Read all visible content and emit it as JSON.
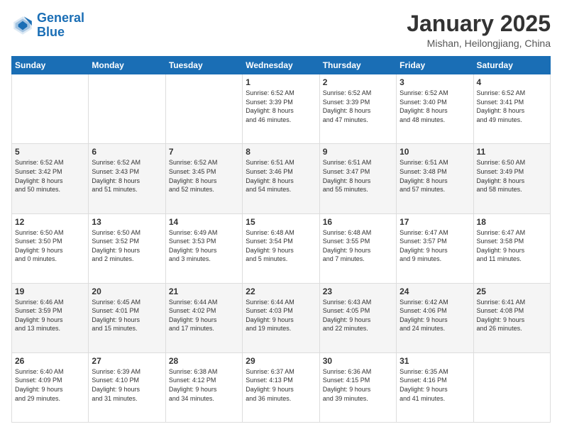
{
  "logo": {
    "line1": "General",
    "line2": "Blue"
  },
  "header": {
    "month": "January 2025",
    "location": "Mishan, Heilongjiang, China"
  },
  "weekdays": [
    "Sunday",
    "Monday",
    "Tuesday",
    "Wednesday",
    "Thursday",
    "Friday",
    "Saturday"
  ],
  "weeks": [
    [
      {
        "num": "",
        "info": ""
      },
      {
        "num": "",
        "info": ""
      },
      {
        "num": "",
        "info": ""
      },
      {
        "num": "1",
        "info": "Sunrise: 6:52 AM\nSunset: 3:39 PM\nDaylight: 8 hours\nand 46 minutes."
      },
      {
        "num": "2",
        "info": "Sunrise: 6:52 AM\nSunset: 3:39 PM\nDaylight: 8 hours\nand 47 minutes."
      },
      {
        "num": "3",
        "info": "Sunrise: 6:52 AM\nSunset: 3:40 PM\nDaylight: 8 hours\nand 48 minutes."
      },
      {
        "num": "4",
        "info": "Sunrise: 6:52 AM\nSunset: 3:41 PM\nDaylight: 8 hours\nand 49 minutes."
      }
    ],
    [
      {
        "num": "5",
        "info": "Sunrise: 6:52 AM\nSunset: 3:42 PM\nDaylight: 8 hours\nand 50 minutes."
      },
      {
        "num": "6",
        "info": "Sunrise: 6:52 AM\nSunset: 3:43 PM\nDaylight: 8 hours\nand 51 minutes."
      },
      {
        "num": "7",
        "info": "Sunrise: 6:52 AM\nSunset: 3:45 PM\nDaylight: 8 hours\nand 52 minutes."
      },
      {
        "num": "8",
        "info": "Sunrise: 6:51 AM\nSunset: 3:46 PM\nDaylight: 8 hours\nand 54 minutes."
      },
      {
        "num": "9",
        "info": "Sunrise: 6:51 AM\nSunset: 3:47 PM\nDaylight: 8 hours\nand 55 minutes."
      },
      {
        "num": "10",
        "info": "Sunrise: 6:51 AM\nSunset: 3:48 PM\nDaylight: 8 hours\nand 57 minutes."
      },
      {
        "num": "11",
        "info": "Sunrise: 6:50 AM\nSunset: 3:49 PM\nDaylight: 8 hours\nand 58 minutes."
      }
    ],
    [
      {
        "num": "12",
        "info": "Sunrise: 6:50 AM\nSunset: 3:50 PM\nDaylight: 9 hours\nand 0 minutes."
      },
      {
        "num": "13",
        "info": "Sunrise: 6:50 AM\nSunset: 3:52 PM\nDaylight: 9 hours\nand 2 minutes."
      },
      {
        "num": "14",
        "info": "Sunrise: 6:49 AM\nSunset: 3:53 PM\nDaylight: 9 hours\nand 3 minutes."
      },
      {
        "num": "15",
        "info": "Sunrise: 6:48 AM\nSunset: 3:54 PM\nDaylight: 9 hours\nand 5 minutes."
      },
      {
        "num": "16",
        "info": "Sunrise: 6:48 AM\nSunset: 3:55 PM\nDaylight: 9 hours\nand 7 minutes."
      },
      {
        "num": "17",
        "info": "Sunrise: 6:47 AM\nSunset: 3:57 PM\nDaylight: 9 hours\nand 9 minutes."
      },
      {
        "num": "18",
        "info": "Sunrise: 6:47 AM\nSunset: 3:58 PM\nDaylight: 9 hours\nand 11 minutes."
      }
    ],
    [
      {
        "num": "19",
        "info": "Sunrise: 6:46 AM\nSunset: 3:59 PM\nDaylight: 9 hours\nand 13 minutes."
      },
      {
        "num": "20",
        "info": "Sunrise: 6:45 AM\nSunset: 4:01 PM\nDaylight: 9 hours\nand 15 minutes."
      },
      {
        "num": "21",
        "info": "Sunrise: 6:44 AM\nSunset: 4:02 PM\nDaylight: 9 hours\nand 17 minutes."
      },
      {
        "num": "22",
        "info": "Sunrise: 6:44 AM\nSunset: 4:03 PM\nDaylight: 9 hours\nand 19 minutes."
      },
      {
        "num": "23",
        "info": "Sunrise: 6:43 AM\nSunset: 4:05 PM\nDaylight: 9 hours\nand 22 minutes."
      },
      {
        "num": "24",
        "info": "Sunrise: 6:42 AM\nSunset: 4:06 PM\nDaylight: 9 hours\nand 24 minutes."
      },
      {
        "num": "25",
        "info": "Sunrise: 6:41 AM\nSunset: 4:08 PM\nDaylight: 9 hours\nand 26 minutes."
      }
    ],
    [
      {
        "num": "26",
        "info": "Sunrise: 6:40 AM\nSunset: 4:09 PM\nDaylight: 9 hours\nand 29 minutes."
      },
      {
        "num": "27",
        "info": "Sunrise: 6:39 AM\nSunset: 4:10 PM\nDaylight: 9 hours\nand 31 minutes."
      },
      {
        "num": "28",
        "info": "Sunrise: 6:38 AM\nSunset: 4:12 PM\nDaylight: 9 hours\nand 34 minutes."
      },
      {
        "num": "29",
        "info": "Sunrise: 6:37 AM\nSunset: 4:13 PM\nDaylight: 9 hours\nand 36 minutes."
      },
      {
        "num": "30",
        "info": "Sunrise: 6:36 AM\nSunset: 4:15 PM\nDaylight: 9 hours\nand 39 minutes."
      },
      {
        "num": "31",
        "info": "Sunrise: 6:35 AM\nSunset: 4:16 PM\nDaylight: 9 hours\nand 41 minutes."
      },
      {
        "num": "",
        "info": ""
      }
    ]
  ]
}
